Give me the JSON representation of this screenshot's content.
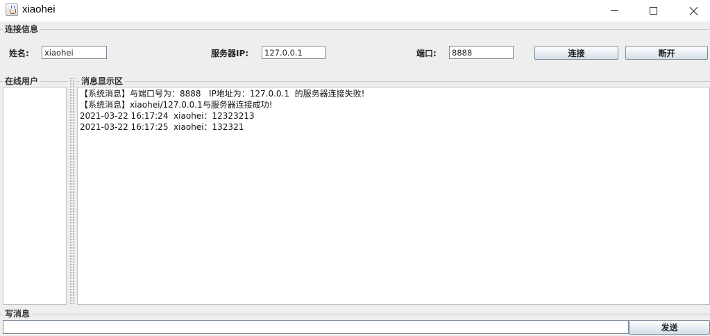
{
  "window": {
    "title": "xiaohei",
    "icon": "java-cup-icon",
    "controls": [
      "minimize-icon",
      "maximize-icon",
      "close-icon"
    ]
  },
  "connection": {
    "group_title": "连接信息",
    "name_label": "姓名:",
    "name_value": "xiaohei",
    "server_label": "服务器IP:",
    "server_value": "127.0.0.1",
    "port_label": "端口:",
    "port_value": "8888",
    "connect_button": "连接",
    "disconnect_button": "断开"
  },
  "online_users": {
    "group_title": "在线用户",
    "items": []
  },
  "messages": {
    "group_title": "消息显示区",
    "lines": [
      "【系统消息】与端口号为：8888   IP地址为：127.0.0.1  的服务器连接失败!",
      "【系统消息】xiaohei/127.0.0.1与服务器连接成功!",
      "2021-03-22 16:17:24  xiaohei：12323213",
      "2021-03-22 16:17:25  xiaohei：132321"
    ]
  },
  "compose": {
    "group_title": "写消息",
    "input_value": "",
    "send_button": "发送"
  }
}
